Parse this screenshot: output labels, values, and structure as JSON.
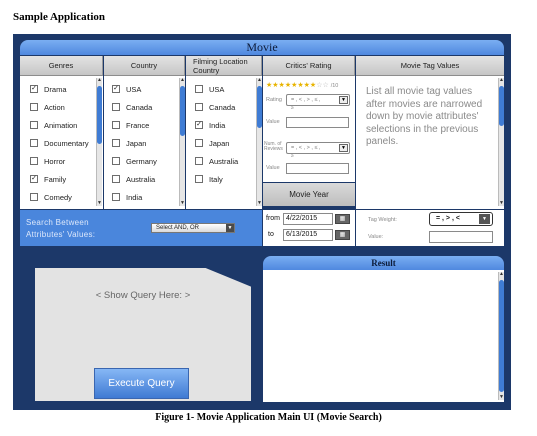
{
  "page": {
    "heading": "Sample Application",
    "caption": "Figure 1- Movie Application Main UI (Movie Search)"
  },
  "window": {
    "title": "Movie"
  },
  "genres": {
    "header": "Genres",
    "items": [
      {
        "label": "Drama",
        "checked": true
      },
      {
        "label": "Action",
        "checked": false
      },
      {
        "label": "Animation",
        "checked": false
      },
      {
        "label": "Documentary",
        "checked": false
      },
      {
        "label": "Horror",
        "checked": false
      },
      {
        "label": "Family",
        "checked": true
      },
      {
        "label": "Comedy",
        "checked": false
      }
    ]
  },
  "country": {
    "header": "Country",
    "items": [
      {
        "label": "USA",
        "checked": true
      },
      {
        "label": "Canada",
        "checked": false
      },
      {
        "label": "France",
        "checked": false
      },
      {
        "label": "Japan",
        "checked": false
      },
      {
        "label": "Germany",
        "checked": false
      },
      {
        "label": "Australia",
        "checked": false
      },
      {
        "label": "India",
        "checked": false
      }
    ]
  },
  "filming": {
    "header": "Filming  Location Country",
    "items": [
      {
        "label": "USA",
        "checked": false
      },
      {
        "label": "Canada",
        "checked": false
      },
      {
        "label": "India",
        "checked": true
      },
      {
        "label": "Japan",
        "checked": false
      },
      {
        "label": "Australia",
        "checked": false
      },
      {
        "label": "Italy",
        "checked": false
      }
    ]
  },
  "critics": {
    "header": "Critics' Rating",
    "stars": "★★★★★★★★",
    "empty_stars": "☆☆",
    "scale": "/10",
    "rating_label": "Rating",
    "rating_op_placeholder": "= , < , > , ≤ ,",
    "rating_op_sub": "≥",
    "value_label": "Value",
    "reviews_label": "Num. of Reviews",
    "reviews_op_placeholder": "= , < , > , ≤ ,",
    "reviews_op_sub": "≥",
    "reviews_value_label": "Value"
  },
  "movie_year": {
    "header": "Movie Year",
    "from_label": "from",
    "from_value": "4/22/2015",
    "to_label": "to",
    "to_value": "6/13/2015"
  },
  "tags": {
    "header": "Movie Tag Values",
    "description": "List all movie tag values after movies are narrowed down by movie attributes' selections in the previous panels.",
    "weight_label": "Tag Weight:",
    "weight_ops": "= , > , <",
    "value_label": "Value:"
  },
  "search": {
    "label_line1": "Search  Between",
    "label_line2": "Attributes'  Values:",
    "select_value": "Select AND, OR"
  },
  "query": {
    "placeholder": "< Show Query Here: >",
    "execute_label": "Execute Query"
  },
  "result": {
    "header": "Result"
  },
  "icons": {
    "dropdown": "▼",
    "scroll_up": "▲",
    "scroll_down": "▼",
    "checkmark": "✓",
    "calendar": "▦"
  },
  "colors": {
    "frame": "#1c3869",
    "accent_blue": "#4f88df",
    "scroll_thumb": "#3f7cd4"
  }
}
